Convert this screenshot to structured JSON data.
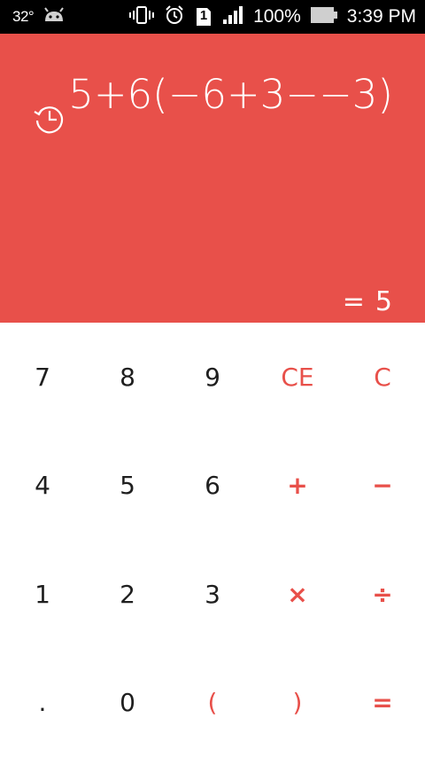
{
  "status_bar": {
    "temperature": "32°",
    "battery_percent": "100%",
    "time": "3:39 PM",
    "sim_slot": "1",
    "icons": [
      "android-icon",
      "vibrate-icon",
      "alarm-icon",
      "sim-icon",
      "signal-icon",
      "battery-icon"
    ]
  },
  "display": {
    "expression": "5+6(−6+3−−3)",
    "result_prefix": "=",
    "result_value": "5",
    "history_icon": "history-icon"
  },
  "keypad": {
    "row1": [
      "7",
      "8",
      "9",
      "CE",
      "C"
    ],
    "row2": [
      "4",
      "5",
      "6",
      "+",
      "−"
    ],
    "row3": [
      "1",
      "2",
      "3",
      "×",
      "÷"
    ],
    "row4": [
      ".",
      "0",
      "(",
      ")",
      "="
    ]
  },
  "colors": {
    "accent": "#e8504a",
    "key_text": "#1f1f1f",
    "status_bar_bg": "#000000",
    "background": "#ffffff"
  }
}
